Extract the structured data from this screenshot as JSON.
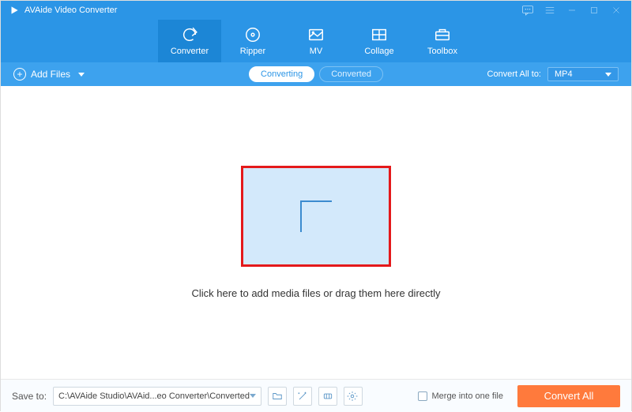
{
  "app": {
    "title": "AVAide Video Converter"
  },
  "nav": {
    "items": [
      {
        "label": "Converter"
      },
      {
        "label": "Ripper"
      },
      {
        "label": "MV"
      },
      {
        "label": "Collage"
      },
      {
        "label": "Toolbox"
      }
    ]
  },
  "toolbar": {
    "add_files": "Add Files",
    "tab_converting": "Converting",
    "tab_converted": "Converted",
    "convert_all_label": "Convert All to:",
    "format_selected": "MP4"
  },
  "main": {
    "hint": "Click here to add media files or drag them here directly"
  },
  "footer": {
    "save_to_label": "Save to:",
    "path": "C:\\AVAide Studio\\AVAid...eo Converter\\Converted",
    "merge_label": "Merge into one file",
    "convert_all_btn": "Convert All"
  }
}
